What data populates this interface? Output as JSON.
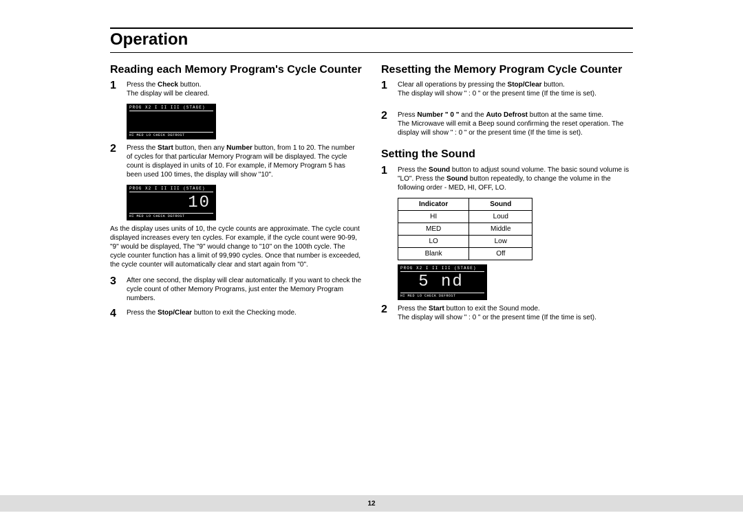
{
  "page_title": "Operation",
  "page_number": "12",
  "left": {
    "heading": "Reading each Memory Program's Cycle Counter",
    "step1_a": "Press the ",
    "step1_b": "Check",
    "step1_c": " button.",
    "step1_d": "The display will be cleared.",
    "display1_top": "PROG  X2    I    II    III  (STAGE)",
    "display1_mid": "",
    "display1_bot": "HI   MED   LO  CHECK DEFROST",
    "step2_a": "Press the ",
    "step2_b": "Start",
    "step2_c": " button, then any ",
    "step2_d": "Number",
    "step2_e": " button, from 1 to 20. The number of cycles for that particular Memory Program will be displayed. The cycle count is displayed in units of 10. For example, if Memory Program 5 has been used 100 times, the display will show \"10\".",
    "display2_top": "PROG  X2    I    II    III  (STAGE)",
    "display2_mid": "10",
    "display2_bot": "HI   MED   LO  CHECK DEFROST",
    "para": "As the display uses units of 10, the cycle counts are approximate. The cycle count displayed increases every ten cycles. For example, if the cycle count were 90-99, \"9\" would be displayed, The \"9\" would change to \"10\" on the 100th cycle. The cycle counter function has a limit of 99,990 cycles. Once that number is exceeded, the cycle counter will automatically clear and start again from \"0\".",
    "step3": "After one second, the display will clear automatically. If you want to check the cycle count of other Memory Programs, just enter the Memory Program numbers.",
    "step4_a": "Press the ",
    "step4_b": "Stop/Clear",
    "step4_c": " button to exit the Checking mode."
  },
  "right": {
    "heading1": "Resetting the Memory Program Cycle Counter",
    "r1_a": "Clear all operations by pressing the ",
    "r1_b": "Stop/Clear",
    "r1_c": "  button.",
    "r1_d": "The display will show \" : 0 \" or the present time (If the time is set).",
    "r2_a": "Press ",
    "r2_b": "Number  \" 0 \"",
    "r2_c": " and the ",
    "r2_d": "Auto Defrost",
    "r2_e": "  button at the same time.",
    "r2_f": "The Microwave will emit a Beep sound confirming the reset operation. The display will show \" : 0 \" or the present time (If the time is set).",
    "heading2": "Setting the Sound",
    "s1_a": "Press the ",
    "s1_b": "Sound",
    "s1_c": " button to adjust sound volume. The basic sound volume is \"LO\". Press the ",
    "s1_d": "Sound",
    "s1_e": " button repeatedly, to change the volume in the following order - MED, HI, OFF, LO.",
    "table": {
      "h1": "Indicator",
      "h2": "Sound",
      "rows": [
        {
          "a": "HI",
          "b": "Loud"
        },
        {
          "a": "MED",
          "b": "Middle"
        },
        {
          "a": "LO",
          "b": "Low"
        },
        {
          "a": "Blank",
          "b": "Off"
        }
      ]
    },
    "display3_top": "PROG  X2    I    II    III  (STAGE)",
    "display3_mid": "5 nd",
    "display3_bot": "HI   MED   LO  CHECK DEFROST",
    "s2_a": "Press the ",
    "s2_b": "Start",
    "s2_c": " button to exit the Sound mode.",
    "s2_d": "The display will show  \" : 0 \" or the present time (If the time is set)."
  }
}
